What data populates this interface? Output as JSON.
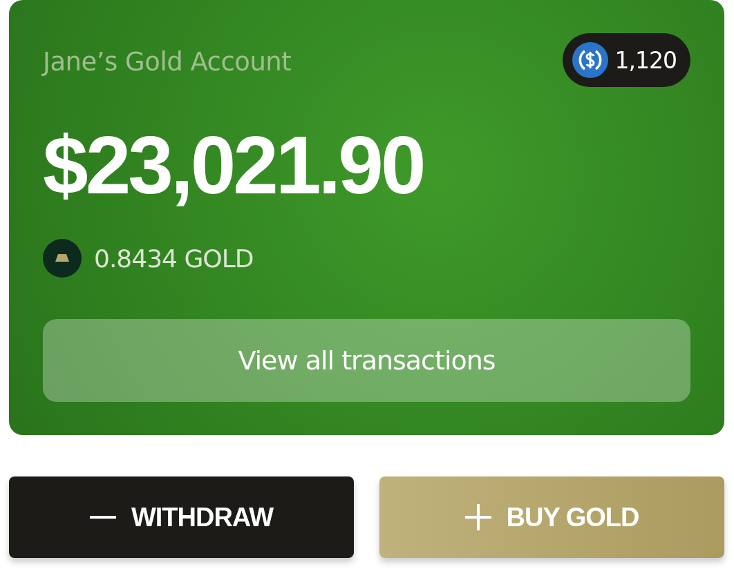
{
  "account": {
    "title": "Jane’s Gold Account",
    "coin_balance": "1,120",
    "amount": "$23,021.90",
    "gold_amount": "0.8434 GOLD",
    "transactions_button": "View all transactions"
  },
  "actions": [
    {
      "kind": "withdraw",
      "label": "WITHDRAW"
    },
    {
      "kind": "buy",
      "label": "BUY GOLD"
    }
  ]
}
